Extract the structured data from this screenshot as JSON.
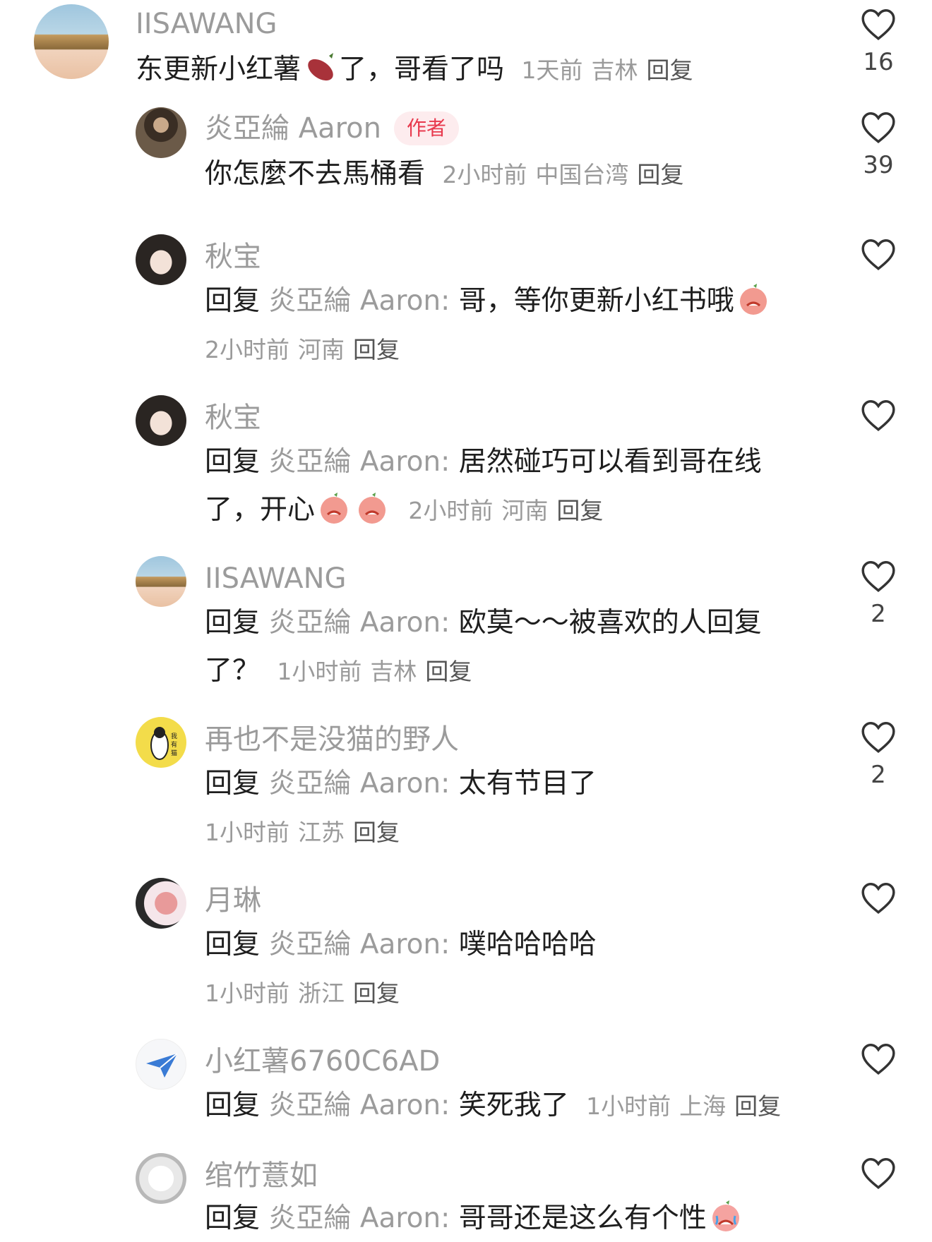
{
  "comments": [
    {
      "user": "IISAWANG",
      "text": "东更新小红薯",
      "text_after": "了，哥看了吗",
      "time": "1天前",
      "location": "吉林",
      "reply_label": "回复",
      "likes": "16"
    },
    {
      "user": "炎亞綸 Aaron",
      "badge": "作者",
      "text": "你怎麼不去馬桶看",
      "time": "2小时前",
      "location": "中国台湾",
      "reply_label": "回复",
      "likes": "39"
    },
    {
      "user": "秋宝",
      "reply_prefix": "回复",
      "reply_target": "炎亞綸 Aaron:",
      "text": "哥，等你更新小红书哦",
      "time": "2小时前",
      "location": "河南",
      "reply_label": "回复",
      "likes": ""
    },
    {
      "user": "秋宝",
      "reply_prefix": "回复",
      "reply_target": "炎亞綸 Aaron:",
      "text": "居然碰巧可以看到哥在线",
      "text2": "了，开心",
      "time": "2小时前",
      "location": "河南",
      "reply_label": "回复",
      "likes": ""
    },
    {
      "user": "IISAWANG",
      "reply_prefix": "回复",
      "reply_target": "炎亞綸 Aaron:",
      "text": "欧莫～～被喜欢的人回复",
      "text2": "了？",
      "time": "1小时前",
      "location": "吉林",
      "reply_label": "回复",
      "likes": "2"
    },
    {
      "user": "再也不是没猫的野人",
      "reply_prefix": "回复",
      "reply_target": "炎亞綸 Aaron:",
      "text": "太有节目了",
      "time": "1小时前",
      "location": "江苏",
      "reply_label": "回复",
      "likes": "2"
    },
    {
      "user": "月琳",
      "reply_prefix": "回复",
      "reply_target": "炎亞綸 Aaron:",
      "text": "噗哈哈哈哈",
      "time": "1小时前",
      "location": "浙江",
      "reply_label": "回复",
      "likes": ""
    },
    {
      "user": "小红薯6760C6AD",
      "reply_prefix": "回复",
      "reply_target": "炎亞綸 Aaron:",
      "text": "笑死我了",
      "time": "1小时前",
      "location": "上海",
      "reply_label": "回复",
      "likes": ""
    },
    {
      "user": "绾竹薏如",
      "reply_prefix": "回复",
      "reply_target": "炎亞綸 Aaron:",
      "text": "哥哥还是这么有个性",
      "likes": ""
    }
  ],
  "colors": {
    "author_badge": "#e8394d",
    "muted": "#9b9b9b",
    "heart_stroke": "#333333"
  }
}
